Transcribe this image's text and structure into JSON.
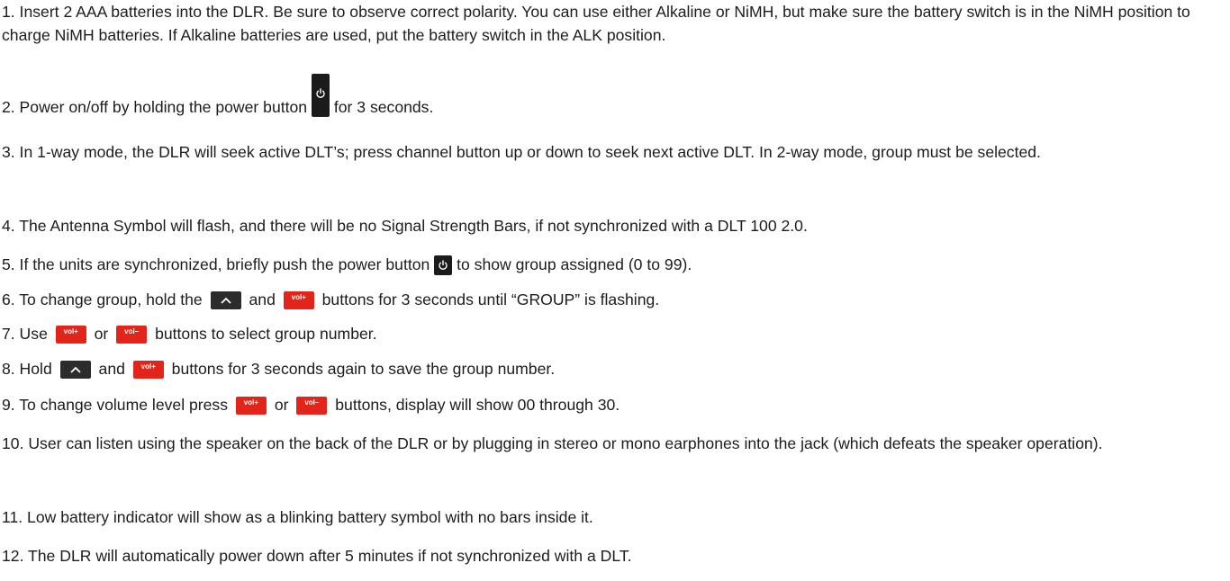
{
  "colors": {
    "text": "#1c1c1c",
    "power_button": "#1b1b1b",
    "arrow_button": "#2c2c2c",
    "volume_button": "#e2241a"
  },
  "icons": {
    "power": "power-icon",
    "up": "chevron-up-icon"
  },
  "buttons": {
    "vol_plus": "vol+",
    "vol_minus": "vol–"
  },
  "steps": {
    "s1": "1. Insert 2 AAA batteries into the DLR. Be sure to observe correct polarity.  You can use either Alkaline or NiMH, but make sure the battery switch is in the NiMH position to charge NiMH batteries.  If Alkaline batteries are used, put the battery switch in the ALK position.",
    "s2a": "2. Power on/off by holding the power button",
    "s2b": "for 3 seconds.",
    "s3": "3. In 1-way mode, the DLR will seek active DLT’s; press channel button up or down to seek next active DLT.  In 2-way mode, group must be selected.",
    "s4": "4. The Antenna Symbol will flash, and there will be no Signal Strength Bars, if not synchronized with a DLT 100 2.0.",
    "s5a": "5. If the units are synchronized, briefly push the power button",
    "s5b": "to show group assigned (0 to 99).",
    "s6a": "6. To change group, hold the",
    "s6b": "and",
    "s6c": "buttons for 3 seconds until “GROUP” is flashing.",
    "s7a": "7. Use",
    "s7b": "or",
    "s7c": "buttons to select group number.",
    "s8a": "8. Hold",
    "s8b": "and",
    "s8c": "buttons for 3 seconds again to save the group number.",
    "s9a": "9. To change volume level press",
    "s9b": "or",
    "s9c": "buttons, display will show 00 through 30.",
    "s10": "10. User can listen using the speaker on the back of the DLR or by plugging in stereo or mono earphones into the jack (which defeats the speaker operation).",
    "s11": "11. Low battery indicator will show as a blinking battery symbol with no bars inside it.",
    "s12": "12. The DLR will automatically power down after 5 minutes if not synchronized with a DLT."
  }
}
